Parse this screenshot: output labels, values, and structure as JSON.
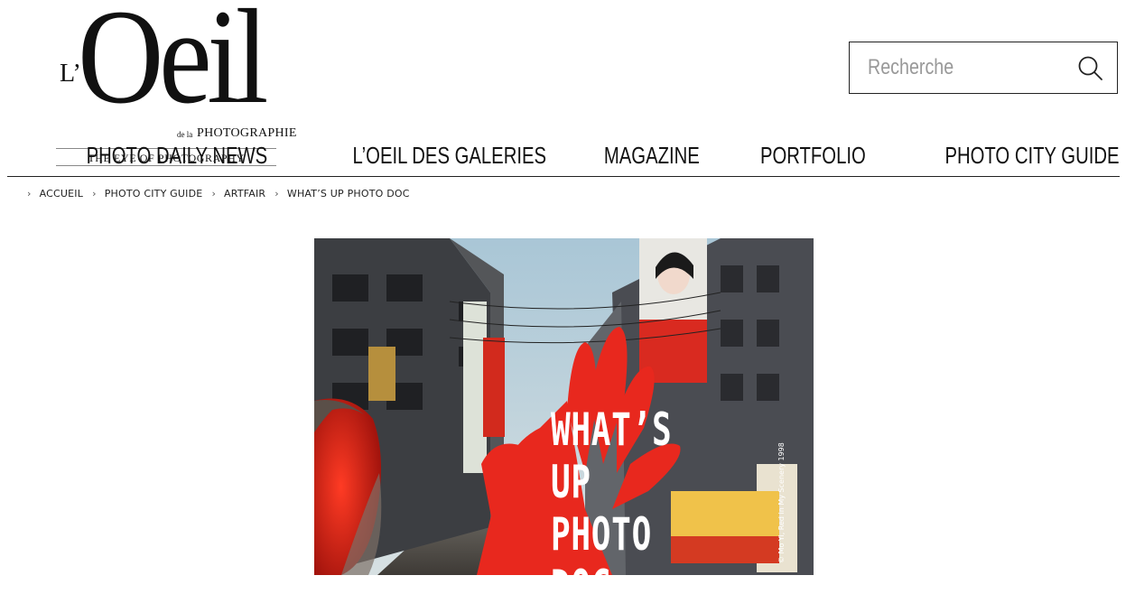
{
  "logo": {
    "prefix": "L’",
    "main": "Oeil",
    "de_la": "de la",
    "photographie": "PHOTOGRAPHIE",
    "tagline": "THE EYE OF PHOTOGRAPHY"
  },
  "search": {
    "placeholder": "Recherche",
    "icon": "search-icon"
  },
  "nav": {
    "items": [
      "PHOTO DAILY NEWS",
      "L’OEIL DES GALERIES",
      "MAGAZINE",
      "PORTFOLIO",
      "PHOTO CITY GUIDE"
    ]
  },
  "breadcrumb": {
    "separator": "›",
    "items": [
      "ACCUEIL",
      "PHOTO CITY GUIDE",
      "ARTFAIR",
      "WHAT’S UP PHOTO DOC"
    ]
  },
  "hero": {
    "title": "WHAT’S UP\nPHOTO DOC",
    "credit": "© Mo Yi, Red in My Scenery 1998"
  },
  "colors": {
    "red": "#e8281e",
    "sky": "#b9ccd4",
    "text": "#111111"
  }
}
